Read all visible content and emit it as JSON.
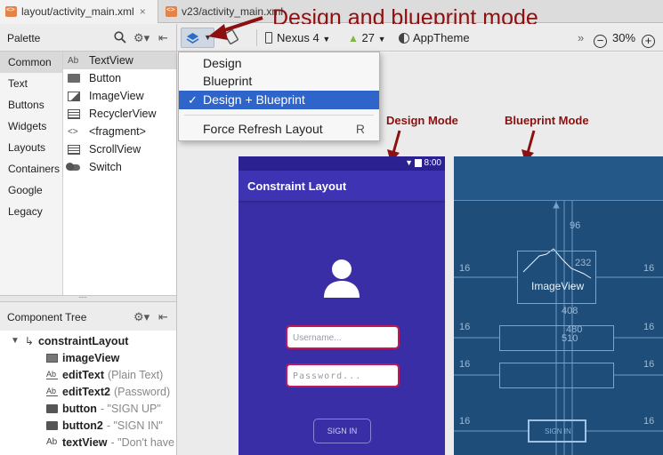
{
  "tabs": [
    {
      "label": "layout/activity_main.xml",
      "active": true
    },
    {
      "label": "v23/activity_main.xml",
      "active": false
    }
  ],
  "heading_annotation": "Design and blueprint mode",
  "palette": {
    "title": "Palette",
    "categories": [
      "Common",
      "Text",
      "Buttons",
      "Widgets",
      "Layouts",
      "Containers",
      "Google",
      "Legacy"
    ],
    "selected_category": "Common",
    "widgets": [
      {
        "label": "TextView",
        "icon": "textview-icon",
        "prefix": "Ab"
      },
      {
        "label": "Button",
        "icon": "button-icon"
      },
      {
        "label": "ImageView",
        "icon": "imageview-icon"
      },
      {
        "label": "RecyclerView",
        "icon": "recyclerview-icon"
      },
      {
        "label": "<fragment>",
        "icon": "fragment-icon",
        "prefix": "<>"
      },
      {
        "label": "ScrollView",
        "icon": "scrollview-icon"
      },
      {
        "label": "Switch",
        "icon": "switch-icon"
      }
    ]
  },
  "toolbar": {
    "device": "Nexus 4",
    "api": "27",
    "theme": "AppTheme",
    "overflow": "»",
    "zoom_out": "−",
    "zoom": "30%",
    "zoom_in": "+"
  },
  "view_menu": {
    "items": [
      {
        "label": "Design"
      },
      {
        "label": "Blueprint"
      },
      {
        "label": "Design + Blueprint",
        "checked": true
      },
      {
        "label": "Force Refresh Layout",
        "shortcut": "R"
      }
    ]
  },
  "component_tree": {
    "title": "Component Tree",
    "root": "constraintLayout",
    "items": [
      {
        "name": "imageView",
        "detail": ""
      },
      {
        "name": "editText",
        "detail": "(Plain Text)"
      },
      {
        "name": "editText2",
        "detail": "(Password)"
      },
      {
        "name": "button",
        "detail": "- \"SIGN UP\""
      },
      {
        "name": "button2",
        "detail": "- \"SIGN IN\""
      },
      {
        "name": "textView",
        "detail": "- \"Don't have"
      }
    ]
  },
  "design_mode": {
    "annotation": "Design Mode",
    "status_time": "8:00",
    "app_title": "Constraint Layout",
    "username_placeholder": "Username...",
    "password_placeholder": "Password...",
    "sign_in_label": "SIGN IN"
  },
  "blueprint_mode": {
    "annotation": "Blueprint Mode",
    "image_label": "ImageView",
    "margins": [
      "16",
      "16",
      "16",
      "16",
      "16",
      "16",
      "16",
      "16"
    ],
    "dims": [
      "96",
      "232",
      "408",
      "480",
      "510"
    ],
    "sign_in_label": "SIGN IN"
  },
  "colors": {
    "annotation": "#8e0f0f",
    "design_bg": "#3a2ea6",
    "blueprint_bg": "#1e4d7a",
    "menu_highlight": "#2f65ca",
    "edit_border": "#c2185b"
  }
}
